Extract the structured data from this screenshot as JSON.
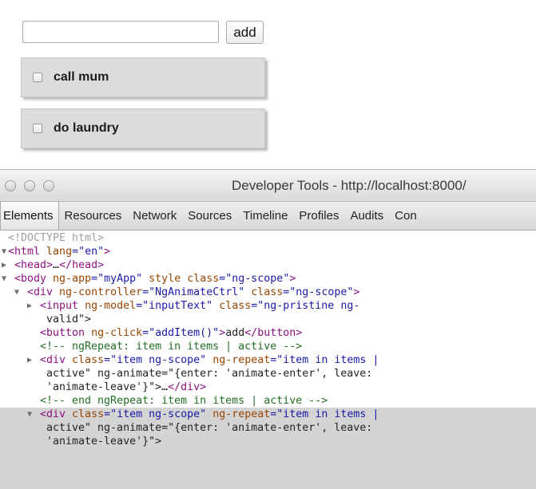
{
  "app": {
    "input": {
      "value": "",
      "placeholder": ""
    },
    "add_button_label": "add",
    "items": [
      {
        "label": "call mum",
        "checked": false
      },
      {
        "label": "do laundry",
        "checked": false
      }
    ]
  },
  "devtools": {
    "window_title": "Developer Tools - http://localhost:8000/",
    "tabs": [
      "Elements",
      "Resources",
      "Network",
      "Sources",
      "Timeline",
      "Profiles",
      "Audits",
      "Con"
    ],
    "active_tab": "Elements",
    "dom_lines": [
      {
        "arrow": "",
        "text": "<!DOCTYPE html>"
      },
      {
        "arrow": "expanded",
        "text": "<html lang=\"en\">"
      },
      {
        "arrow": "collapsed",
        "text": "<head>…</head>"
      },
      {
        "arrow": "expanded",
        "text": "<body ng-app=\"myApp\" style class=\"ng-scope\">"
      },
      {
        "arrow": "expanded",
        "text": "<div ng-controller=\"NgAnimateCtrl\" class=\"ng-scope\">"
      },
      {
        "arrow": "collapsed",
        "text": "<input ng-model=\"inputText\" class=\"ng-pristine ng-"
      },
      {
        "arrow": "",
        "text": "valid\">"
      },
      {
        "arrow": "",
        "text": "<button ng-click=\"addItem()\">add</button>"
      },
      {
        "arrow": "",
        "text": "<!-- ngRepeat: item in items | active -->"
      },
      {
        "arrow": "collapsed",
        "text": "<div class=\"item ng-scope\" ng-repeat=\"item in items |"
      },
      {
        "arrow": "",
        "text": "active\" ng-animate=\"{enter: 'animate-enter', leave:"
      },
      {
        "arrow": "",
        "text": "'animate-leave'}\">…</div>"
      },
      {
        "arrow": "",
        "text": "<!-- end ngRepeat: item in items | active -->"
      },
      {
        "arrow": "expanded",
        "text": "<div class=\"item ng-scope\" ng-repeat=\"item in items |"
      },
      {
        "arrow": "",
        "text": "active\" ng-animate=\"{enter: 'animate-enter', leave:"
      },
      {
        "arrow": "",
        "text": "'animate-leave'}\">"
      }
    ]
  }
}
